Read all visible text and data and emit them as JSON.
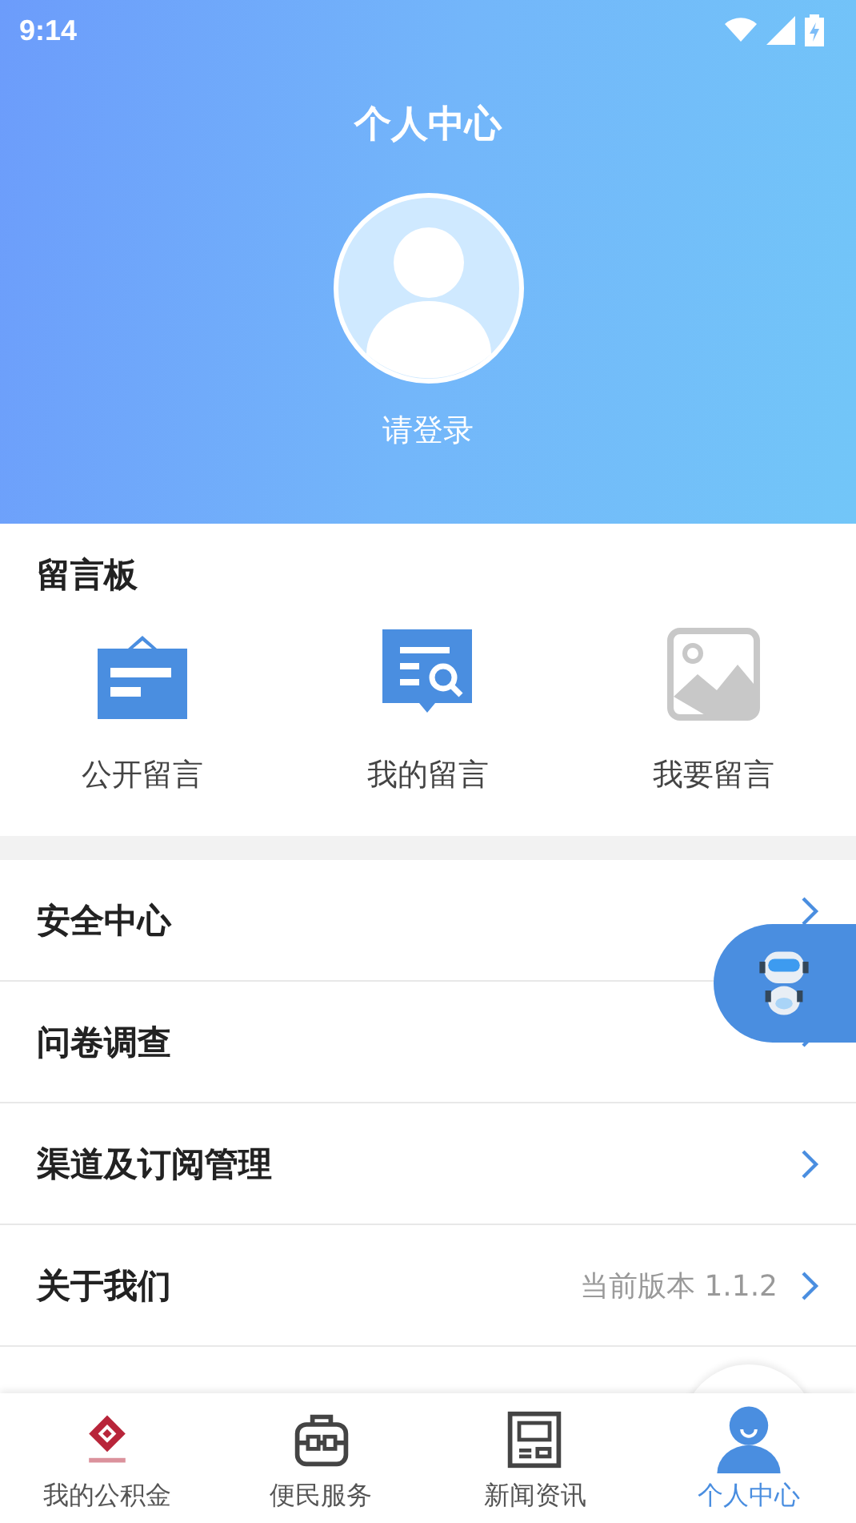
{
  "status_bar": {
    "time": "9:14"
  },
  "header": {
    "title": "个人中心",
    "login_label": "请登录"
  },
  "message_board": {
    "title": "留言板",
    "items": [
      {
        "kind": "notice",
        "label": "公开留言"
      },
      {
        "kind": "search",
        "label": "我的留言"
      },
      {
        "kind": "image",
        "label": "我要留言"
      }
    ]
  },
  "menu": [
    {
      "label": "安全中心"
    },
    {
      "label": "问卷调查"
    },
    {
      "label": "渠道及订阅管理"
    },
    {
      "label": "关于我们",
      "value": "当前版本 1.1.2"
    }
  ],
  "tab_bar": [
    {
      "kind": "logo",
      "label": "我的公积金",
      "selected": false
    },
    {
      "kind": "briefcase",
      "label": "便民服务",
      "selected": false
    },
    {
      "kind": "news",
      "label": "新闻资讯",
      "selected": false
    },
    {
      "kind": "person",
      "label": "个人中心",
      "selected": true
    }
  ]
}
